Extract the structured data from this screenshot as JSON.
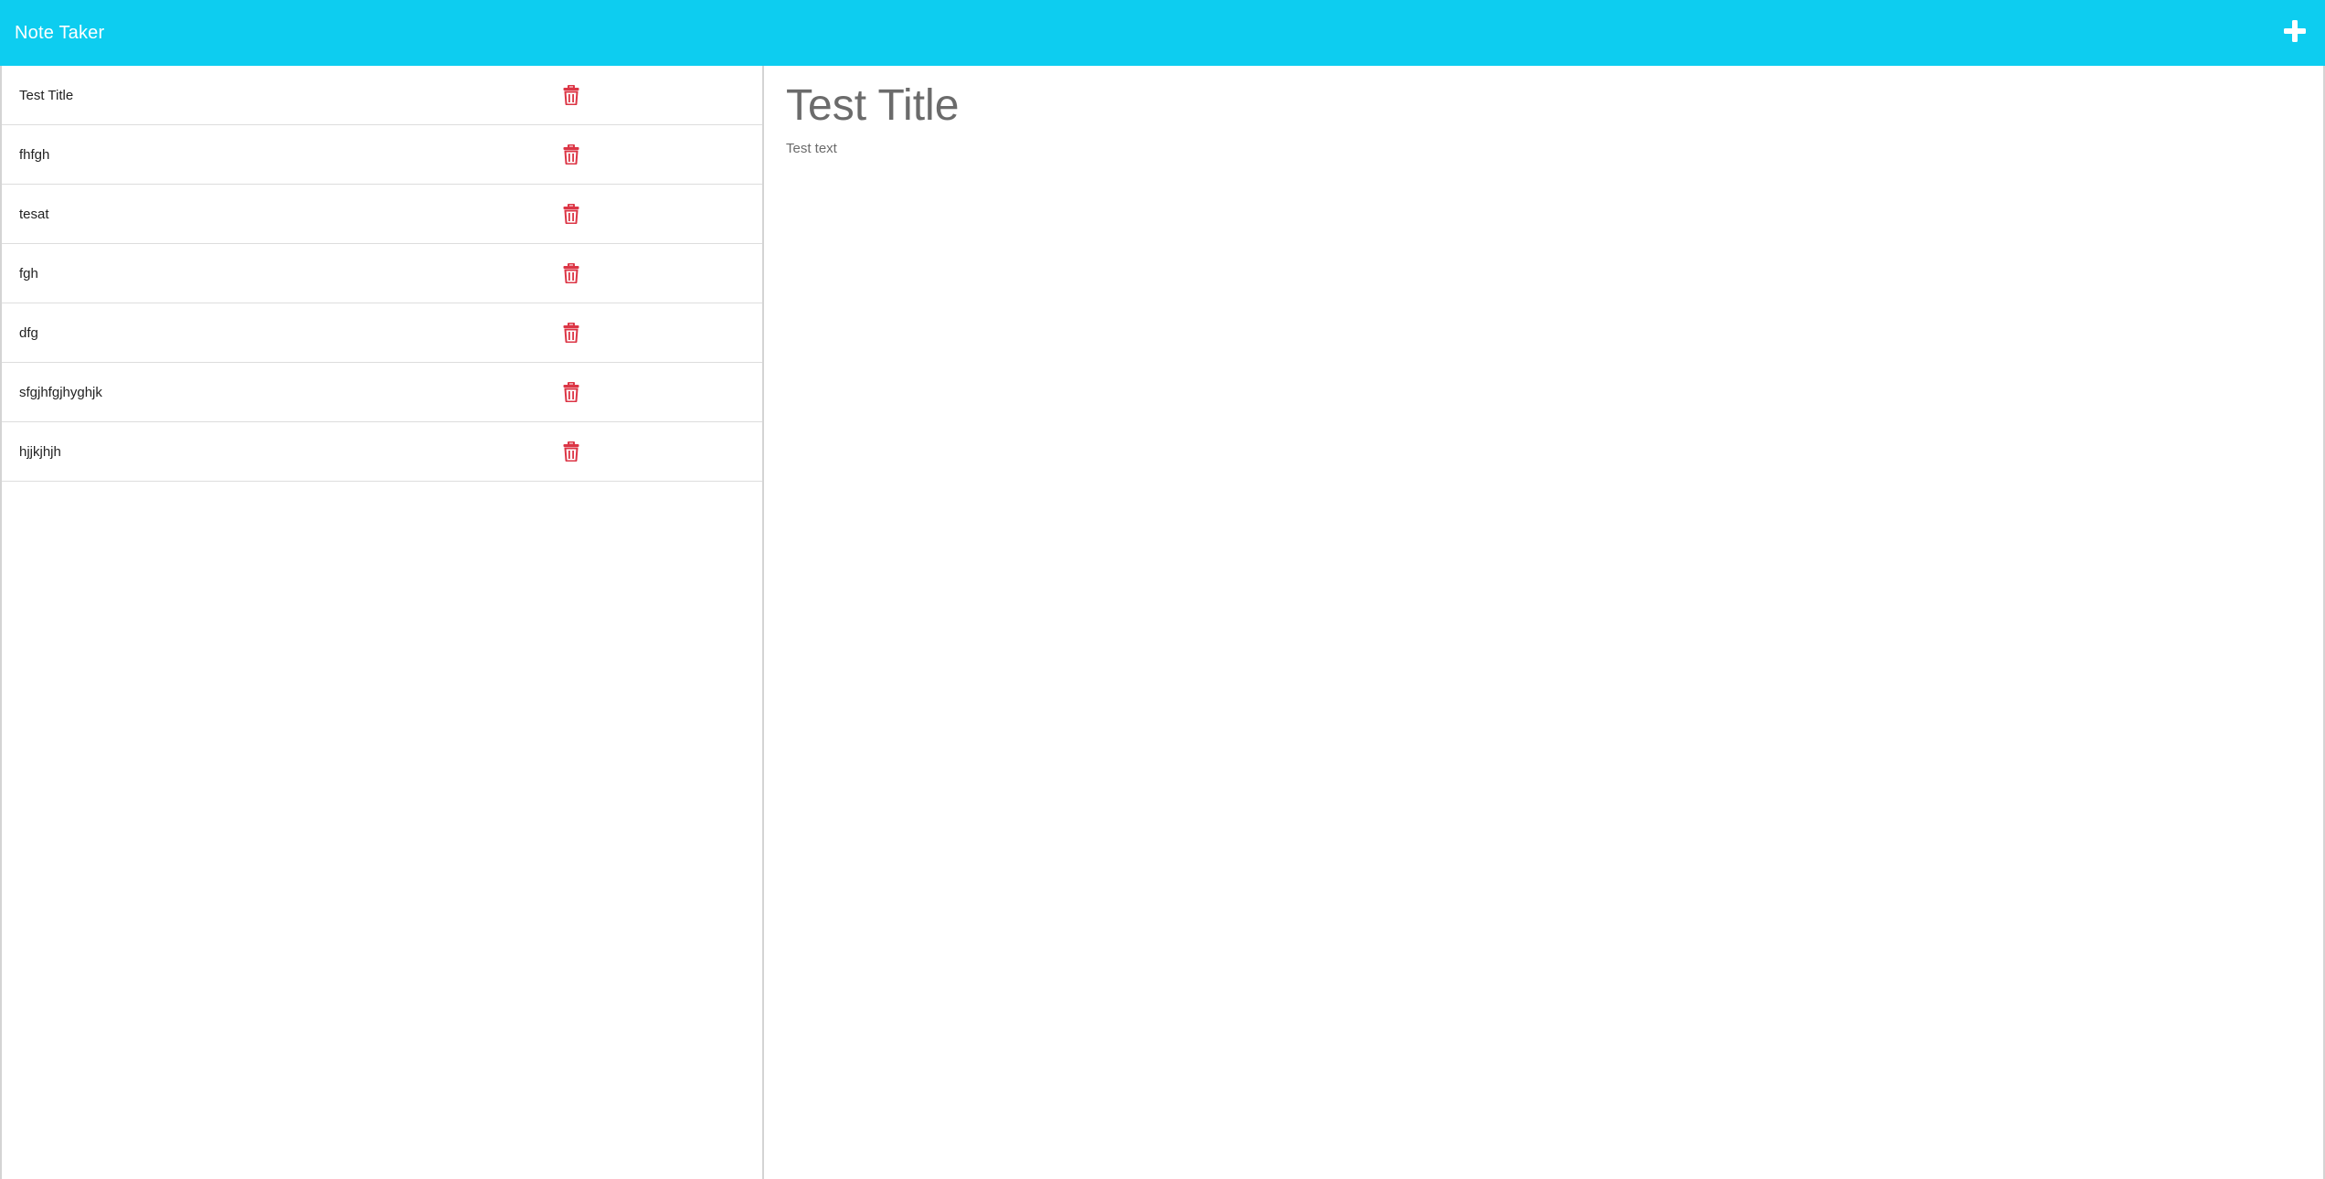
{
  "navbar": {
    "brand": "Note Taker",
    "new_note_icon": "plus-icon",
    "color": "#0dcdf0"
  },
  "notes": [
    {
      "title": "Test Title",
      "delete_icon": "trash-icon"
    },
    {
      "title": "fhfgh",
      "delete_icon": "trash-icon"
    },
    {
      "title": "tesat",
      "delete_icon": "trash-icon"
    },
    {
      "title": "fgh",
      "delete_icon": "trash-icon"
    },
    {
      "title": "dfg",
      "delete_icon": "trash-icon"
    },
    {
      "title": "sfgjhfgjhyghjk",
      "delete_icon": "trash-icon"
    },
    {
      "title": "hjjkjhjh",
      "delete_icon": "trash-icon"
    }
  ],
  "editor": {
    "title": "Test Title",
    "text": "Test text"
  },
  "colors": {
    "delete_icon": "#dc3545",
    "editor_text": "#6b6b6b"
  }
}
